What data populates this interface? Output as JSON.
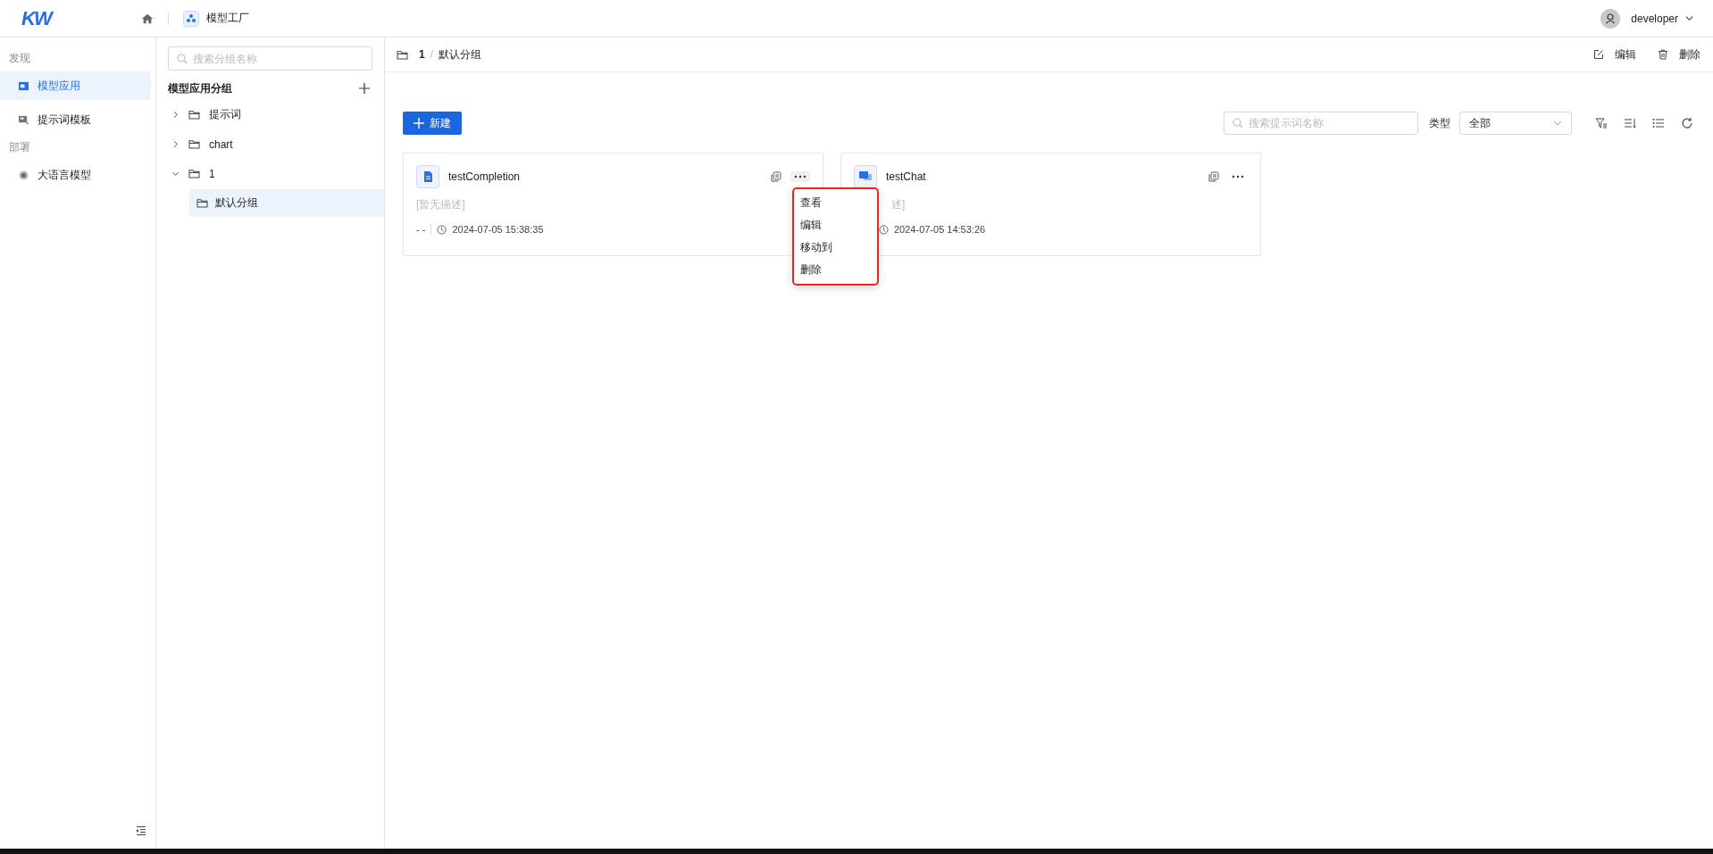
{
  "header": {
    "logo": "KW",
    "app_name": "模型工厂",
    "user": "developer"
  },
  "sidebar": {
    "sections": [
      {
        "title": "发现",
        "items": [
          {
            "label": "模型应用",
            "selected": true,
            "kind": "app"
          },
          {
            "label": "提示词模板",
            "selected": false,
            "kind": "template"
          }
        ]
      },
      {
        "title": "部署",
        "items": [
          {
            "label": "大语言模型",
            "selected": false,
            "kind": "model"
          }
        ]
      }
    ]
  },
  "group_panel": {
    "search": {
      "placeholder": "搜索分组名称"
    },
    "title": "模型应用分组",
    "tree": [
      {
        "label": "提示词",
        "expanded": false,
        "selected": false
      },
      {
        "label": "chart",
        "expanded": false,
        "selected": false
      },
      {
        "label": "1",
        "expanded": true,
        "selected": false,
        "children": [
          {
            "label": "默认分组",
            "selected": true
          }
        ]
      }
    ]
  },
  "breadcrumb": {
    "parent": "1",
    "separator": "/",
    "current": "默认分组",
    "actions": [
      {
        "label": "编辑",
        "kind": "edit"
      },
      {
        "label": "删除",
        "kind": "delete"
      }
    ]
  },
  "toolbar": {
    "new_button": "新建",
    "search": {
      "placeholder": "搜索提示词名称"
    },
    "type_label": "类型",
    "type_value": "全部"
  },
  "cards": [
    {
      "name": "testCompletion",
      "kind": "completion",
      "description": "[暂无描述]",
      "owner": "- -",
      "time": "2024-07-05 15:38:35",
      "menu": [
        "查看",
        "编辑",
        "移动到",
        "删除"
      ]
    },
    {
      "name": "testChat",
      "kind": "chat",
      "description": "述]",
      "time": "2024-07-05 14:53:26"
    }
  ]
}
